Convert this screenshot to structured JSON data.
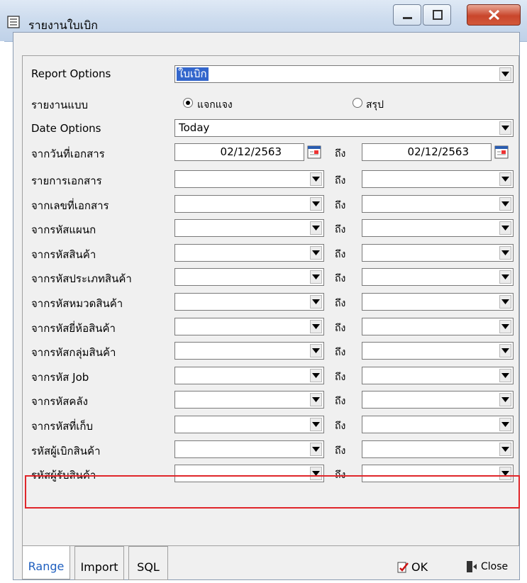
{
  "window": {
    "title": "รายงานใบเบิก",
    "controls": [
      "minimize",
      "maximize",
      "close"
    ]
  },
  "form": {
    "report_options": {
      "label": "Report Options",
      "value": "ใบเบิก"
    },
    "report_type": {
      "label": "รายงานแบบ",
      "options": [
        {
          "label": "แจกแจง",
          "selected": true
        },
        {
          "label": "สรุป",
          "selected": false
        }
      ]
    },
    "date_options": {
      "label": "Date Options",
      "value": "Today"
    },
    "date_range": {
      "label": "จากวันที่เอกสาร",
      "from": "02/12/2563",
      "to_label": "ถึง",
      "to": "02/12/2563"
    },
    "ranges": [
      {
        "label": "รายการเอกสาร",
        "to_label": "ถึง"
      },
      {
        "label": "จากเลขที่เอกสาร",
        "to_label": "ถึง"
      },
      {
        "label": "จากรหัสแผนก",
        "to_label": "ถึง"
      },
      {
        "label": "จากรหัสสินค้า",
        "to_label": "ถึง"
      },
      {
        "label": "จากรหัสประเภทสินค้า",
        "to_label": "ถึง"
      },
      {
        "label": "จากรหัสหมวดสินค้า",
        "to_label": "ถึง"
      },
      {
        "label": "จากรหัสยี่ห้อสินค้า",
        "to_label": "ถึง"
      },
      {
        "label": "จากรหัสกลุ่มสินค้า",
        "to_label": "ถึง"
      },
      {
        "label": "จากรหัส Job",
        "to_label": "ถึง"
      },
      {
        "label": "จากรหัสคลัง",
        "to_label": "ถึง"
      },
      {
        "label": "จากรหัสที่เก็บ",
        "to_label": "ถึง"
      },
      {
        "label": "รหัสผู้เบิกสินค้า",
        "to_label": "ถึง"
      },
      {
        "label": "รหัสผู้รับสินค้า",
        "to_label": "ถึง"
      }
    ]
  },
  "tabs": [
    {
      "label": "Range",
      "active": true
    },
    {
      "label": "Import",
      "active": false
    },
    {
      "label": "SQL",
      "active": false
    }
  ],
  "buttons": {
    "ok": "OK",
    "close": "Close"
  },
  "colors": {
    "highlight": "#e0262a",
    "selection": "#3366cc",
    "active_tab_text": "#1f5fbf"
  }
}
